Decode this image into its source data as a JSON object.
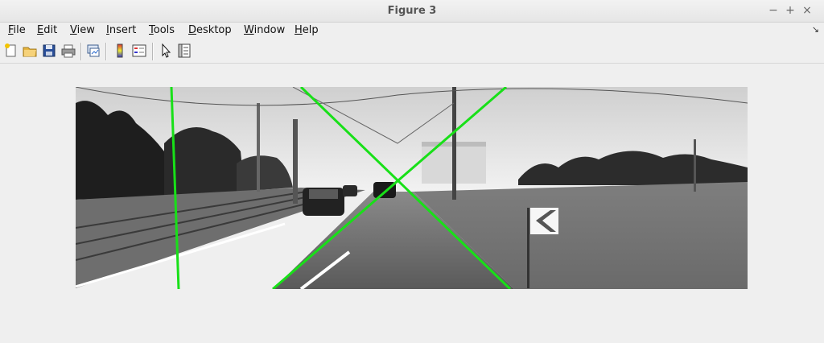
{
  "window": {
    "title": "Figure 3"
  },
  "window_controls": {
    "minimize": "−",
    "maximize": "+",
    "close": "×"
  },
  "menu": {
    "items": [
      "File",
      "Edit",
      "View",
      "Insert",
      "Tools",
      "Desktop",
      "Window",
      "Help"
    ],
    "dock_arrow": "↘"
  },
  "toolbar": {
    "buttons": [
      "new-figure-icon",
      "open-file-icon",
      "save-icon",
      "print-icon",
      "link-plot-icon",
      "colorbar-icon",
      "legend-icon",
      "select-pointer-icon",
      "property-inspector-icon"
    ]
  },
  "figure": {
    "description_colors": {
      "line": "#18e018",
      "background": "#efefef"
    }
  }
}
